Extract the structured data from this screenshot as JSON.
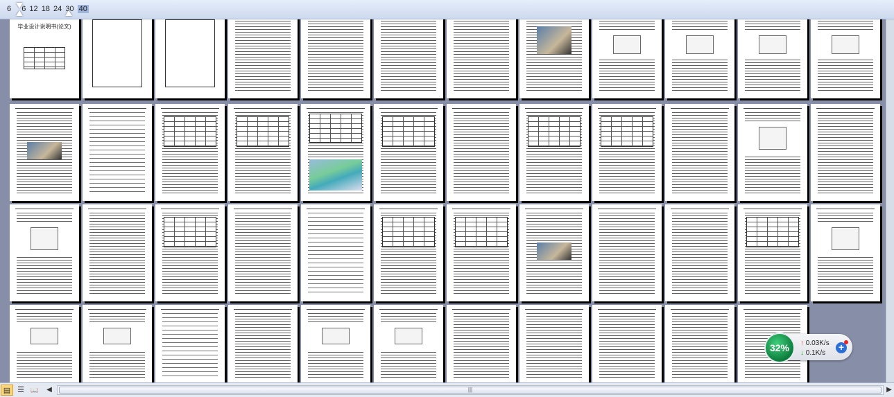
{
  "ruler": {
    "marks": [
      "6",
      "6",
      "12",
      "18",
      "24",
      "30",
      "40"
    ],
    "selected_mark": "40"
  },
  "document": {
    "cover_title": "毕业设计说明书(论文)"
  },
  "scrollbar": {
    "grip": "|||"
  },
  "view_buttons": [
    {
      "name": "print-layout",
      "glyph": "▤"
    },
    {
      "name": "outline",
      "glyph": "☰"
    },
    {
      "name": "reading",
      "glyph": "📖"
    }
  ],
  "network_monitor": {
    "percent": "32%",
    "upload": "0.03K/s",
    "download": "0.1K/s",
    "up_arrow": "↑",
    "down_arrow": "↓",
    "plus": "+"
  }
}
